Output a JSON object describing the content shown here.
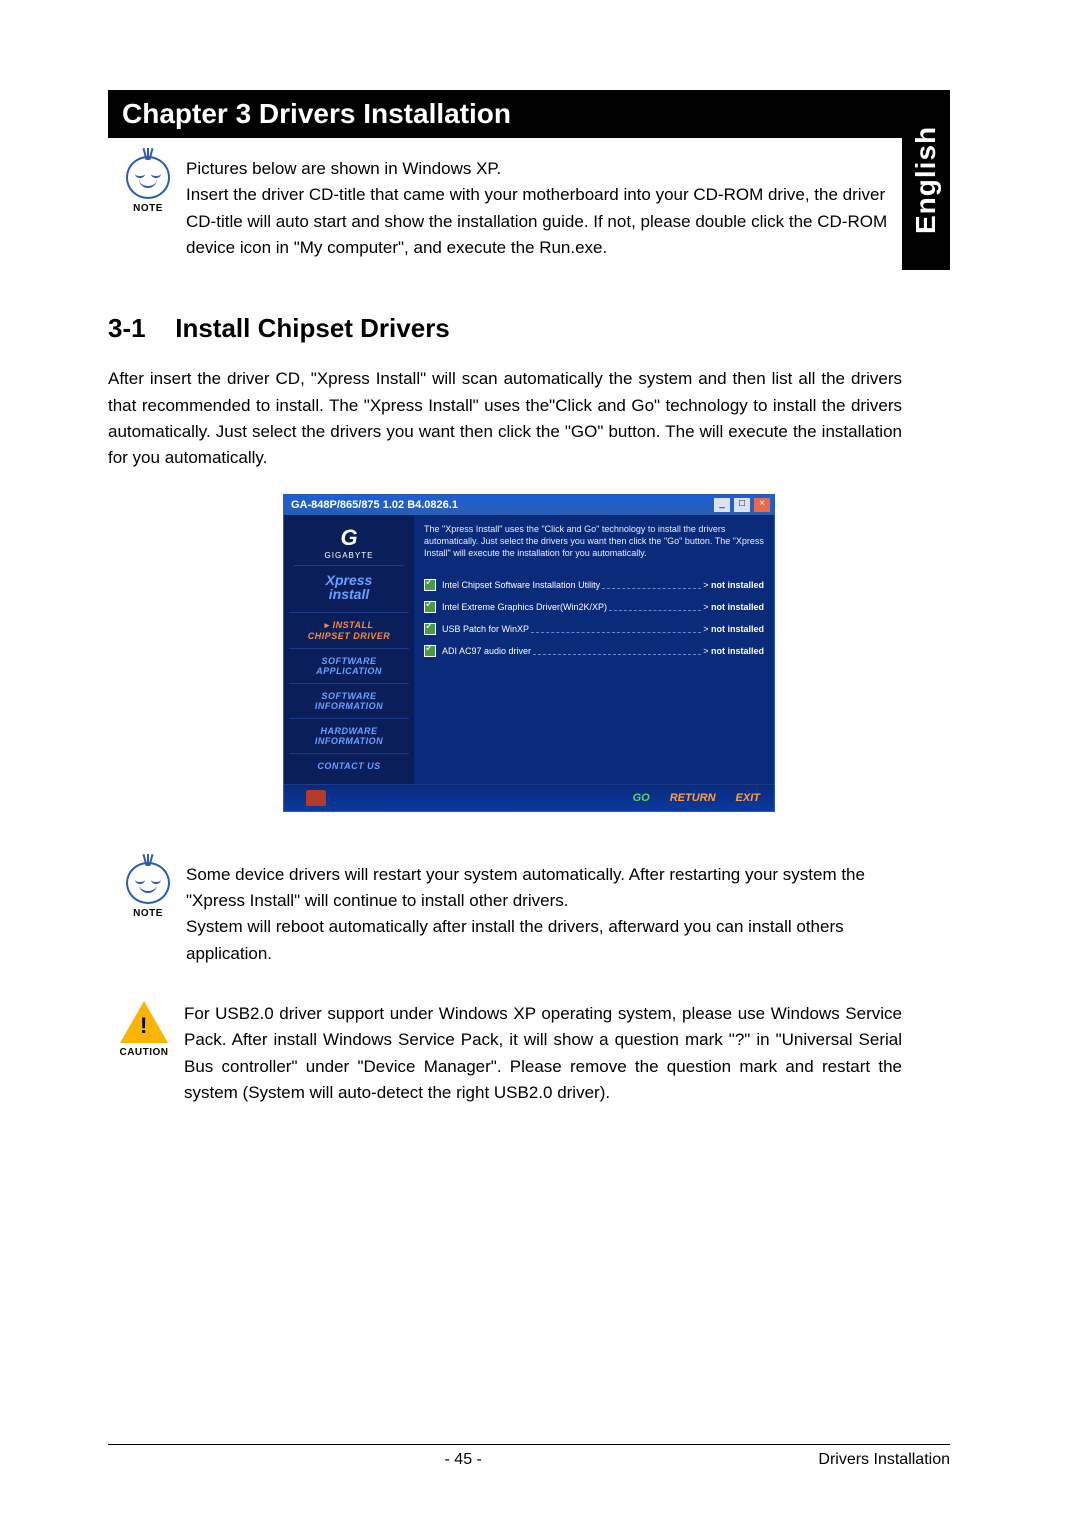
{
  "sideTab": "English",
  "chapter": "Chapter 3 Drivers Installation",
  "noteLabel": "NOTE",
  "note1": "Pictures below are shown in Windows XP.\nInsert the driver CD-title that came with your motherboard into your CD-ROM drive, the driver CD-title will auto start and show the installation guide. If not, please double click the CD-ROM device icon in \"My computer\", and execute the Run.exe.",
  "section": {
    "num": "3-1",
    "title": "Install Chipset Drivers"
  },
  "para1": "After insert the driver CD, \"Xpress Install\" will  scan automatically the system and then list all the drivers that recommended to install. The \"Xpress Install\" uses the\"Click and Go\" technology to install the drivers automatically. Just select the drivers you want then click the \"GO\" button. The will execute the installation for you automatically.",
  "installer": {
    "title": "GA-848P/865/875 1.02 B4.0826.1",
    "winMin": "_",
    "winMax": "□",
    "winClose": "×",
    "logoG": "G",
    "logoSub": "GIGABYTE",
    "xpress1": "Xpress",
    "xpress2": "install",
    "nav": [
      {
        "arrow": "▸",
        "line1": "INSTALL",
        "line2": "CHIPSET DRIVER",
        "active": true
      },
      {
        "line1": "SOFTWARE",
        "line2": "APPLICATION"
      },
      {
        "line1": "SOFTWARE",
        "line2": "INFORMATION"
      },
      {
        "line1": "HARDWARE",
        "line2": "INFORMATION"
      },
      {
        "line1": "CONTACT US",
        "line2": ""
      }
    ],
    "desc": "The \"Xpress Install\" uses the \"Click and Go\" technology to install the drivers automatically. Just select the drivers you want then click the \"Go\" button. The \"Xpress Install\" will execute the installation for you automatically.",
    "drivers": [
      {
        "name": "Intel Chipset Software Installation Utility",
        "status": "not installed"
      },
      {
        "name": "Intel Extreme Graphics Driver(Win2K/XP)",
        "status": "not installed"
      },
      {
        "name": "USB Patch for WinXP",
        "status": "not installed"
      },
      {
        "name": "ADI AC97 audio driver",
        "status": "not installed"
      }
    ],
    "footer": {
      "go": "GO",
      "return": "RETURN",
      "exit": "EXIT"
    }
  },
  "note2": "Some device drivers will restart your system automatically. After restarting your system the \"Xpress Install\" will continue to install other drivers.\nSystem will reboot automatically after install the drivers, afterward you can install others application.",
  "cautionLabel": "CAUTION",
  "caution": "For USB2.0 driver support under Windows XP operating system, please use Windows Service Pack. After install Windows Service Pack, it will show a question mark \"?\" in \"Universal Serial Bus controller\" under \"Device Manager\". Please remove the question mark and restart the system (System will auto-detect the right USB2.0 driver).",
  "footer": {
    "page": "- 45 -",
    "section": "Drivers Installation"
  }
}
